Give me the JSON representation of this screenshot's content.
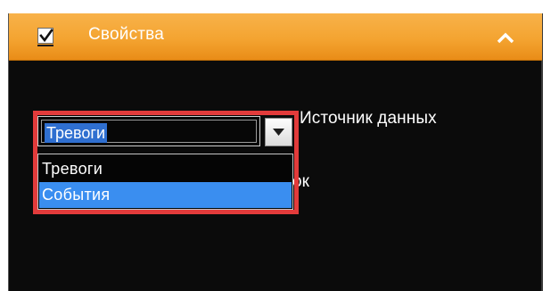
{
  "panel": {
    "title": "Свойства",
    "checkbox_checked": true,
    "collapse_icon": "chevron-up-icon",
    "accent_color": "#f4a431",
    "highlight_color": "#e23b3b"
  },
  "data_source": {
    "label": "Источник данных",
    "selected_value": "Тревоги",
    "options": [
      "Тревоги",
      "События"
    ],
    "hovered_option": "События"
  },
  "obscured_field": {
    "label_fragment": "ок"
  }
}
